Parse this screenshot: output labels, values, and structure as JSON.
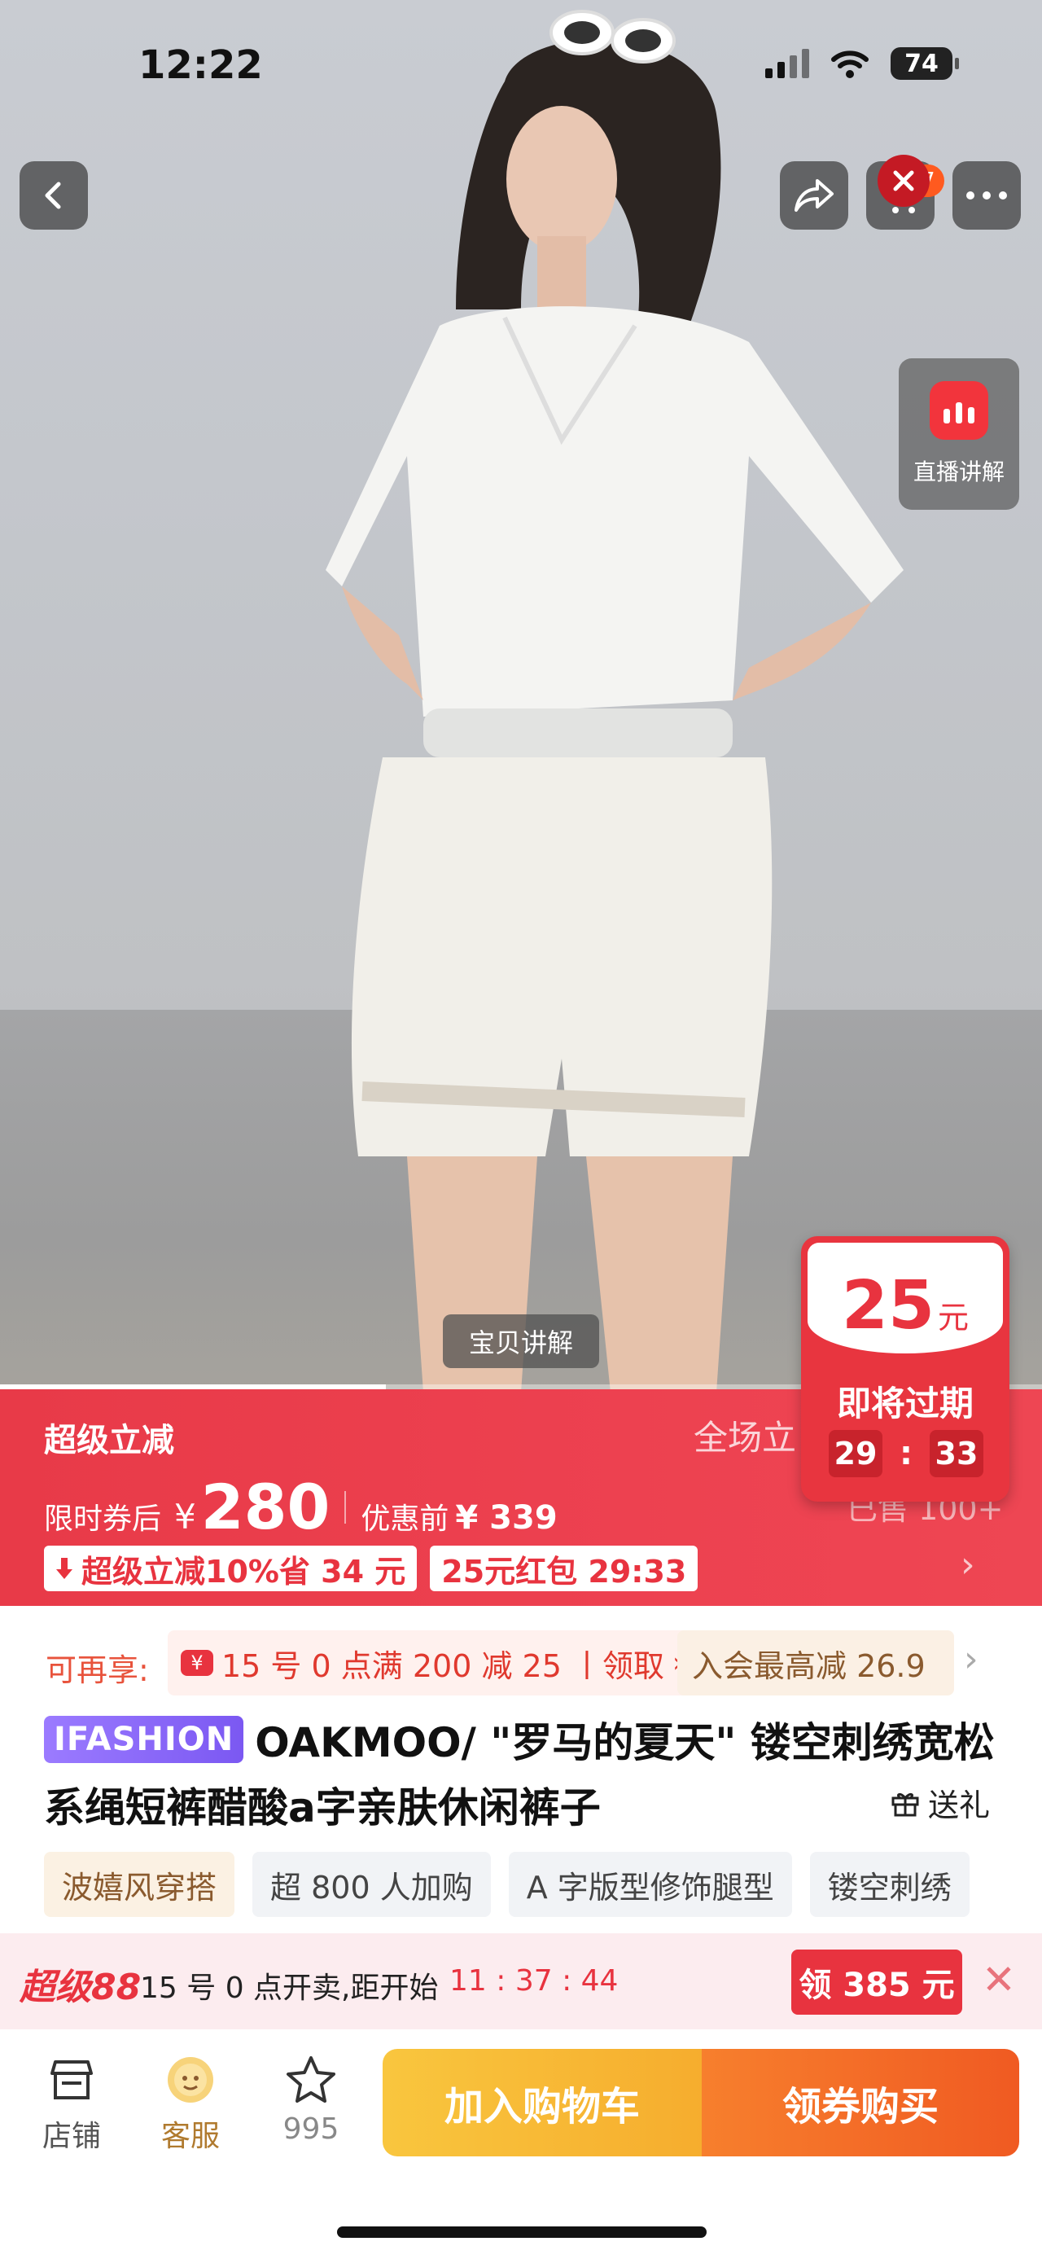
{
  "status_bar": {
    "time": "12:22",
    "battery": "74"
  },
  "nav": {
    "cart_count": "77"
  },
  "live": {
    "label": "直播讲解"
  },
  "media": {
    "explain_label": "宝贝讲解",
    "progress": 0.37
  },
  "promo": {
    "super_label": "超级立减",
    "fullsite": "全场立",
    "sold": "已售 100+",
    "after_coupon_label": "限时券后",
    "currency": "¥",
    "price": "280",
    "before_label": "优惠前",
    "before_price": "¥ 339",
    "chip1": "超级立减10%省 34 元",
    "chip2": "25元红包 29:33"
  },
  "coupon": {
    "amount": "25",
    "unit": "元",
    "status": "即将过期",
    "minutes": "29",
    "seconds": "33"
  },
  "offers": {
    "label": "可再享:",
    "offer1_tag": "¥",
    "offer1": "15 号 0 点满 200 减 25 丨领取",
    "offer2": "入会最高减 26.9"
  },
  "product": {
    "brand_badge": "IFASHION",
    "title": "OAKMOO/ \"罗马的夏天\" 镂空刺绣宽松系绳短裤醋酸a字亲肤休闲裤子",
    "gift_label": "送礼"
  },
  "tags": [
    "波嬉风穿搭",
    "超 800 人加购",
    "A 字版型修饰腿型",
    "镂空刺绣"
  ],
  "bar88": {
    "logo": "超级88",
    "text": "15 号 0 点开卖,距开始",
    "countdown": "11 : 37 : 44",
    "button": "领 385 元"
  },
  "bottom_bar": {
    "shop": "店铺",
    "service": "客服",
    "fav_count": "995",
    "add_cart": "加入购物车",
    "buy": "领券购买"
  },
  "colors": {
    "accent_red": "#e8333f",
    "cart_yellow": "#f9c63e",
    "buy_orange": "#f05a22"
  }
}
